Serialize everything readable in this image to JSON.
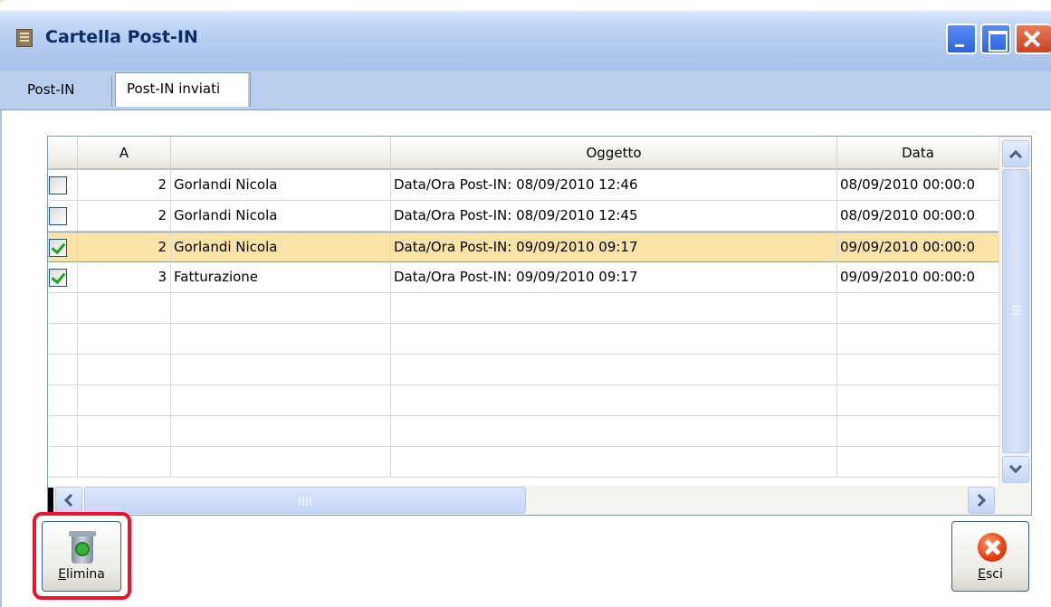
{
  "window": {
    "title": "Cartella Post-IN"
  },
  "tabs": [
    {
      "label": "Post-IN",
      "active": false
    },
    {
      "label": "Post-IN inviati",
      "active": true
    }
  ],
  "grid": {
    "columns": [
      "",
      "A",
      "",
      "Oggetto",
      "Data"
    ],
    "rows": [
      {
        "checked": false,
        "num": "2",
        "name": "Gorlandi Nicola",
        "subject": "Data/Ora Post-IN: 08/09/2010 12:46",
        "date": "08/09/2010 00:00:0"
      },
      {
        "checked": false,
        "num": "2",
        "name": "Gorlandi Nicola",
        "subject": "Data/Ora Post-IN: 08/09/2010 12:45",
        "date": "08/09/2010 00:00:0"
      },
      {
        "checked": true,
        "num": "2",
        "name": "Gorlandi Nicola",
        "subject": "Data/Ora Post-IN: 09/09/2010 09:17",
        "date": "09/09/2010 00:00:0",
        "selected": true
      },
      {
        "checked": true,
        "num": "3",
        "name": "Fatturazione",
        "subject": "Data/Ora Post-IN: 09/09/2010 09:17",
        "date": "09/09/2010 00:00:0"
      }
    ]
  },
  "buttons": {
    "elimina": {
      "label_first": "E",
      "label_rest": "limina",
      "icon": "recycle-bin-icon"
    },
    "esci": {
      "label_first": "E",
      "label_rest": "sci",
      "icon": "close-round-icon"
    }
  },
  "colors": {
    "selected_row": "#fbe2a8",
    "highlight": "#e8152b",
    "title_text": "#0a2c6b"
  }
}
